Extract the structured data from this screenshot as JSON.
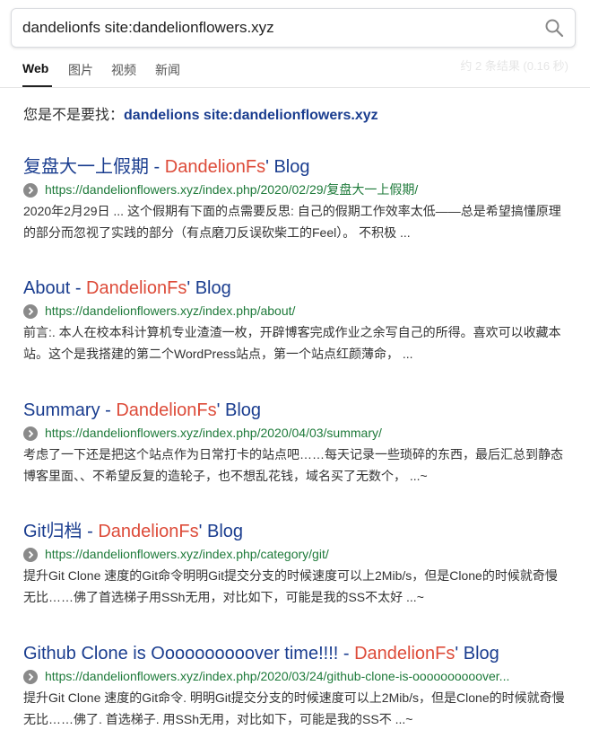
{
  "search": {
    "query": "dandelionfs site:dandelionflowers.xyz"
  },
  "tabs": [
    {
      "label": "Web"
    },
    {
      "label": "图片"
    },
    {
      "label": "视频"
    },
    {
      "label": "新闻"
    }
  ],
  "result_stats": "约 2 条结果 (0.16 秒)",
  "suggestion": {
    "prefix": "您是不是要找：",
    "link": "dandelions site:dandelionflowers.xyz"
  },
  "results": [
    {
      "title_pre": "复盘大一上假期 - ",
      "title_hl": "DandelionFs",
      "title_post": "' Blog",
      "url": "https://dandelionflowers.xyz/index.php/2020/02/29/复盘大一上假期/",
      "snippet": "2020年2月29日 ... 这个假期有下面的点需要反思: 自己的假期工作效率太低——总是希望搞懂原理的部分而忽视了实践的部分（有点磨刀反误砍柴工的Feel）。 不积极 ..."
    },
    {
      "title_pre": "About - ",
      "title_hl": "DandelionFs",
      "title_post": "' Blog",
      "url": "https://dandelionflowers.xyz/index.php/about/",
      "snippet": "前言:. 本人在校本科计算机专业渣渣一枚，开辟博客完成作业之余写自己的所得。喜欢可以收藏本站。这个是我搭建的第二个WordPress站点，第一个站点红颜薄命， ..."
    },
    {
      "title_pre": "Summary - ",
      "title_hl": "DandelionFs",
      "title_post": "' Blog",
      "url": "https://dandelionflowers.xyz/index.php/2020/04/03/summary/",
      "snippet": "考虑了一下还是把这个站点作为日常打卡的站点吧……每天记录一些琐碎的东西，最后汇总到静态博客里面、、不希望反复的造轮子，也不想乱花钱，域名买了无数个， ...~"
    },
    {
      "title_pre": "Git归档 - ",
      "title_hl": "DandelionFs",
      "title_post": "' Blog",
      "url": "https://dandelionflowers.xyz/index.php/category/git/",
      "snippet": "提升Git Clone 速度的Git命令明明Git提交分支的时候速度可以上2Mib/s，但是Clone的时候就奇慢无比……佛了首选梯子用SSh无用，对比如下，可能是我的SS不太好 ...~"
    },
    {
      "title_pre": "Github Clone is Oooooooooover time!!!! - ",
      "title_hl": "DandelionFs",
      "title_post": "' Blog",
      "url": "https://dandelionflowers.xyz/index.php/2020/03/24/github-clone-is-oooooooooover...",
      "snippet": "提升Git Clone 速度的Git命令. 明明Git提交分支的时候速度可以上2Mib/s，但是Clone的时候就奇慢无比……佛了. 首选梯子. 用SSh无用，对比如下，可能是我的SS不 ...~"
    }
  ],
  "icons": {
    "search": "search-icon",
    "url_arrow": "chevron-right-circle-icon"
  },
  "colors": {
    "link": "#1a3d8f",
    "highlight": "#dd4b39",
    "url": "#1e7a3a"
  }
}
